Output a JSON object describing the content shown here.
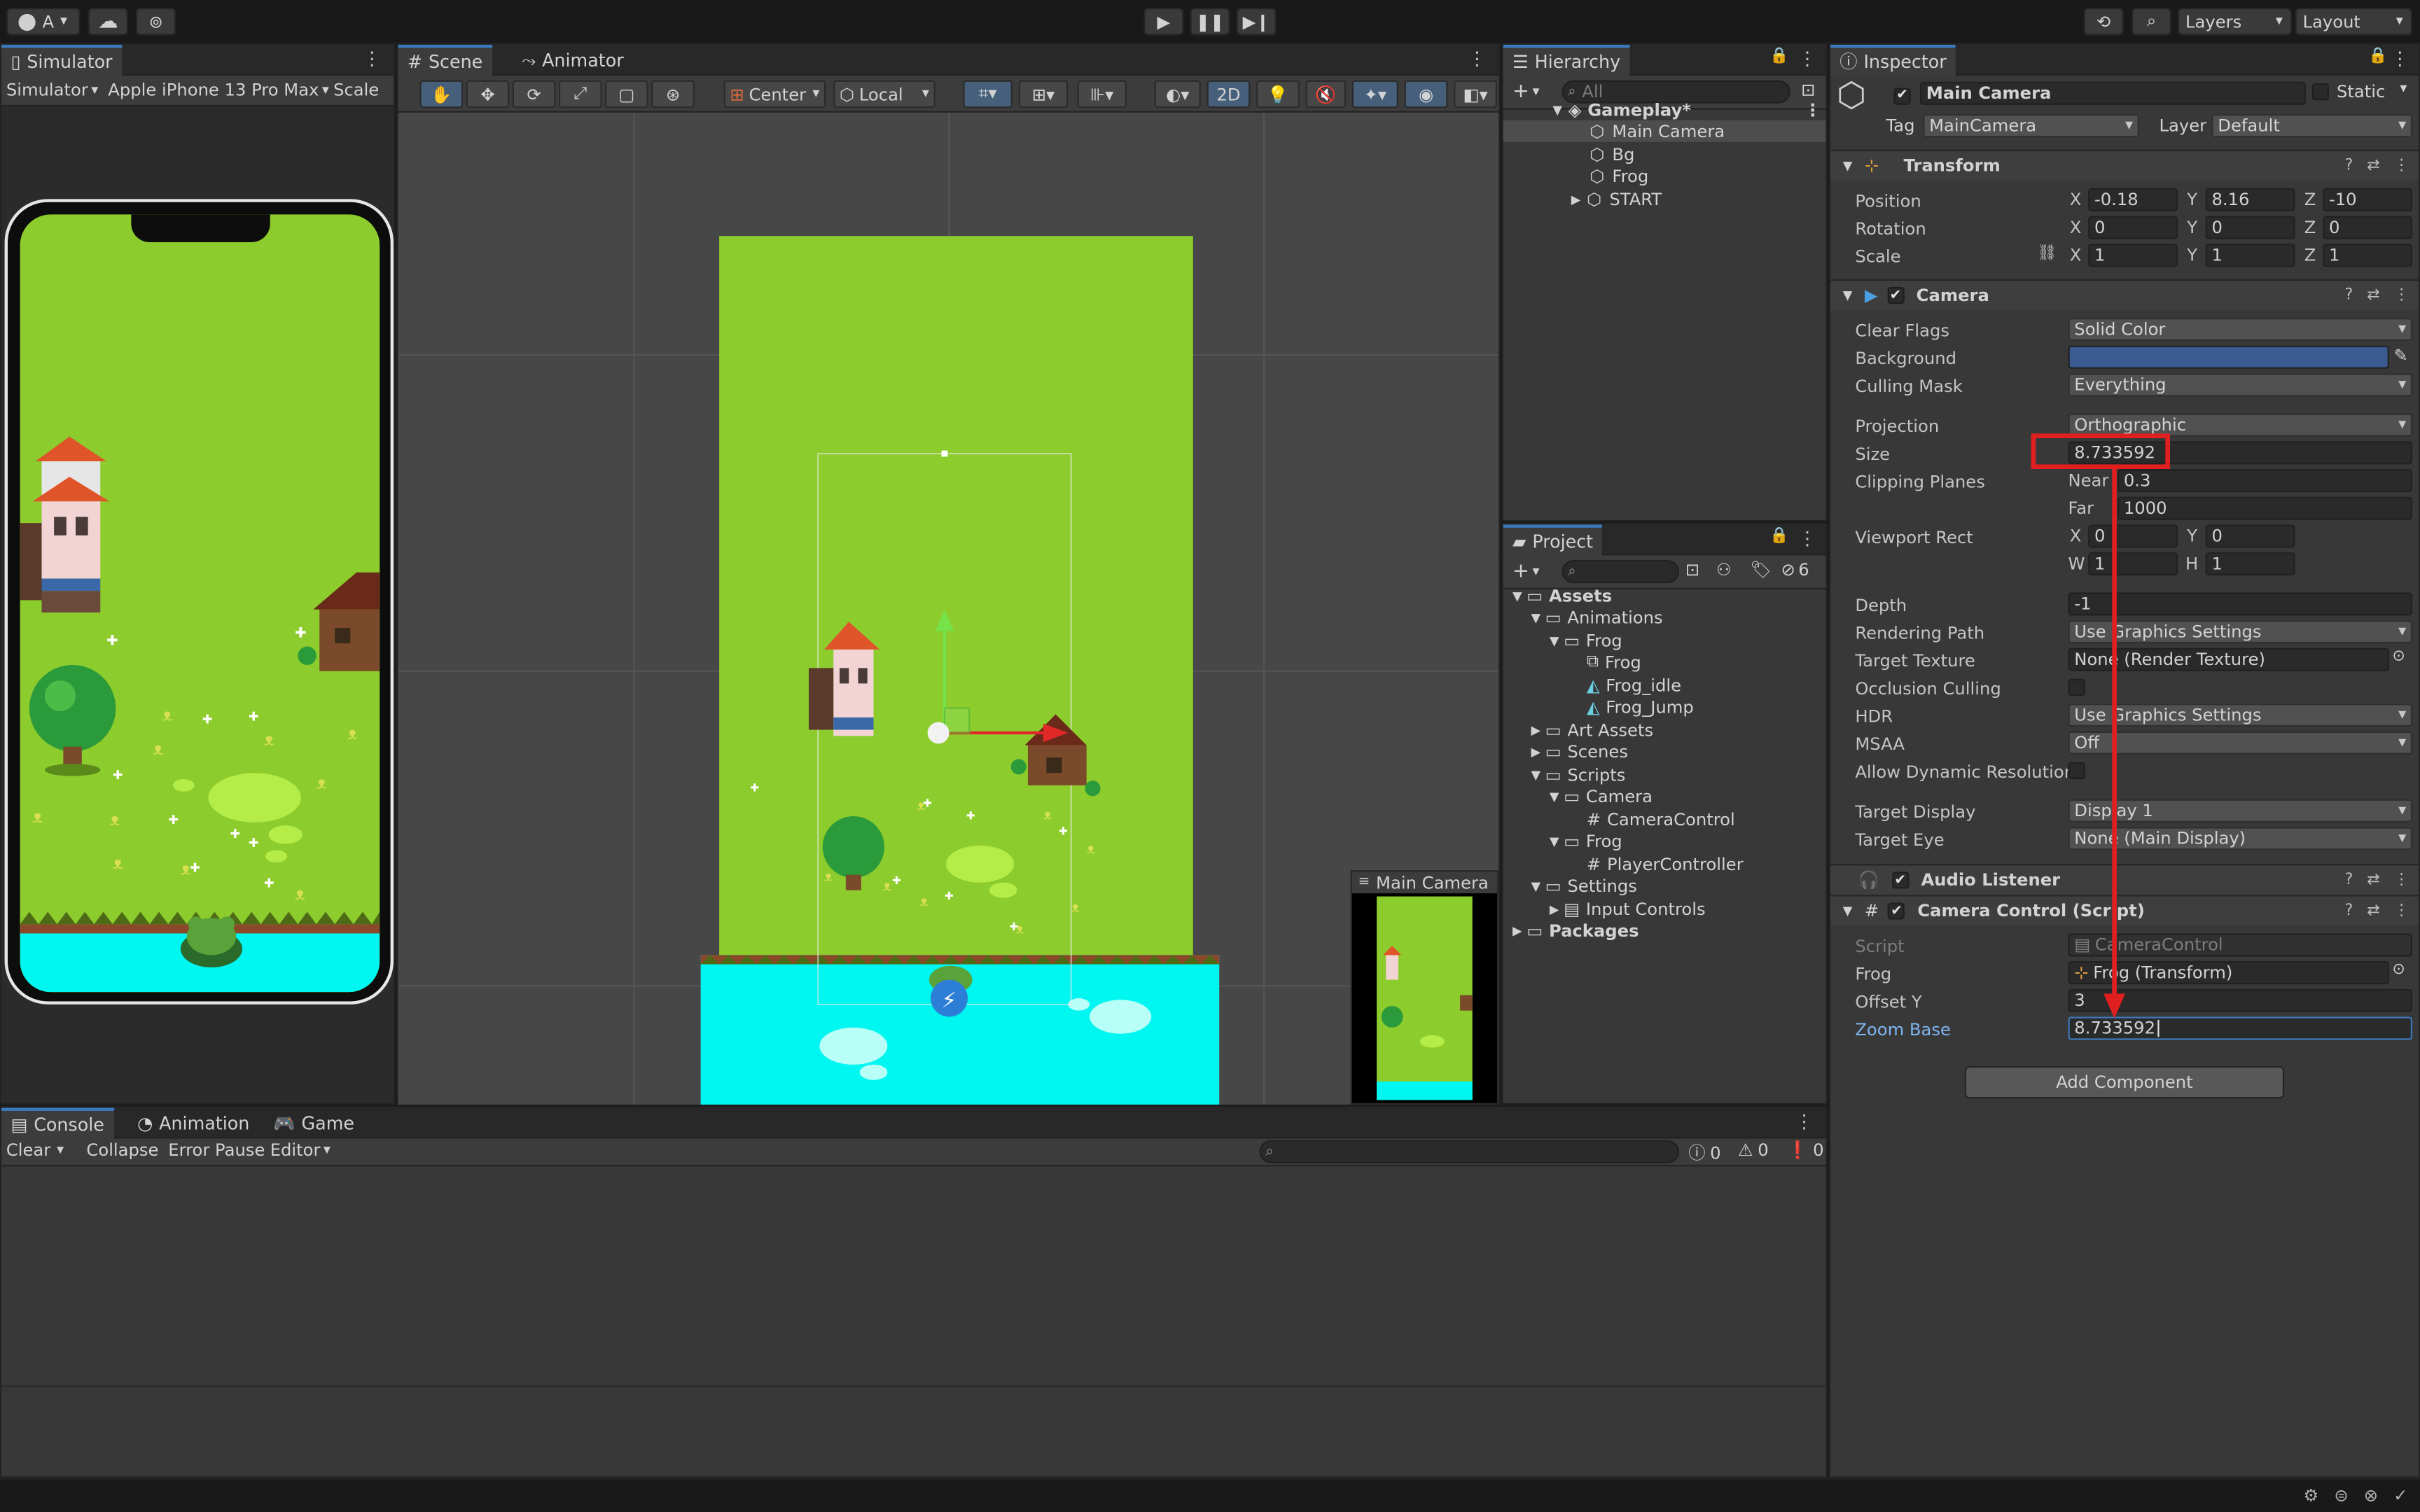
{
  "toolbar": {
    "account": "A",
    "layers": "Layers",
    "layout": "Layout"
  },
  "simulator": {
    "tab": "Simulator",
    "mode": "Simulator",
    "device": "Apple iPhone 13 Pro Max",
    "scale": "Scale"
  },
  "scene": {
    "tab_scene": "Scene",
    "tab_animator": "Animator",
    "pivot": "Center",
    "space": "Local",
    "mode2d": "2D",
    "camera_preview": "Main Camera"
  },
  "hierarchy": {
    "tab": "Hierarchy",
    "search_placeholder": "All",
    "items": [
      {
        "label": "Gameplay*"
      },
      {
        "label": "Main Camera"
      },
      {
        "label": "Bg"
      },
      {
        "label": "Frog"
      },
      {
        "label": "START"
      }
    ]
  },
  "project": {
    "tab": "Project",
    "count": "6",
    "items": [
      {
        "label": "Assets"
      },
      {
        "label": "Animations"
      },
      {
        "label": "Frog"
      },
      {
        "label": "Frog"
      },
      {
        "label": "Frog_idle"
      },
      {
        "label": "Frog_Jump"
      },
      {
        "label": "Art Assets"
      },
      {
        "label": "Scenes"
      },
      {
        "label": "Scripts"
      },
      {
        "label": "Camera"
      },
      {
        "label": "CameraControl"
      },
      {
        "label": "Frog"
      },
      {
        "label": "PlayerController"
      },
      {
        "label": "Settings"
      },
      {
        "label": "Input Controls"
      },
      {
        "label": "Packages"
      }
    ]
  },
  "console": {
    "tabs": [
      "Console",
      "Animation",
      "Game"
    ],
    "buttons": [
      "Clear",
      "Collapse",
      "Error Pause",
      "Editor"
    ],
    "counts": [
      "0",
      "0",
      "0"
    ]
  },
  "inspector": {
    "tab": "Inspector",
    "object_name": "Main Camera",
    "static_label": "Static",
    "tag_label": "Tag",
    "tag_value": "MainCamera",
    "layer_label": "Layer",
    "layer_value": "Default",
    "transform": {
      "title": "Transform",
      "position_label": "Position",
      "rotation_label": "Rotation",
      "scale_label": "Scale",
      "position": [
        "-0.18",
        "8.16",
        "-10"
      ],
      "rotation": [
        "0",
        "0",
        "0"
      ],
      "scale": [
        "1",
        "1",
        "1"
      ],
      "axes": [
        "X",
        "Y",
        "Z"
      ]
    },
    "camera": {
      "title": "Camera",
      "clear_flags_label": "Clear Flags",
      "clear_flags": "Solid Color",
      "background_label": "Background",
      "background_color": "#3b5a8f",
      "culling_mask_label": "Culling Mask",
      "culling_mask": "Everything",
      "projection_label": "Projection",
      "projection": "Orthographic",
      "size_label": "Size",
      "size": "8.733592",
      "clipping_label": "Clipping Planes",
      "near_label": "Near",
      "near": "0.3",
      "far_label": "Far",
      "far": "1000",
      "viewport_label": "Viewport Rect",
      "vp_x_label": "X",
      "vp_x": "0",
      "vp_y_label": "Y",
      "vp_y": "0",
      "vp_w_label": "W",
      "vp_w": "1",
      "vp_h_label": "H",
      "vp_h": "1",
      "depth_label": "Depth",
      "depth": "-1",
      "rendering_path_label": "Rendering Path",
      "rendering_path": "Use Graphics Settings",
      "target_texture_label": "Target Texture",
      "target_texture": "None (Render Texture)",
      "occlusion_label": "Occlusion Culling",
      "hdr_label": "HDR",
      "hdr": "Use Graphics Settings",
      "msaa_label": "MSAA",
      "msaa": "Off",
      "dyn_res_label": "Allow Dynamic Resolution",
      "target_display_label": "Target Display",
      "target_display": "Display 1",
      "target_eye_label": "Target Eye",
      "target_eye": "None (Main Display)"
    },
    "audio_listener": "Audio Listener",
    "camera_control": {
      "title": "Camera Control (Script)",
      "script_label": "Script",
      "script": "CameraControl",
      "frog_label": "Frog",
      "frog": "Frog (Transform)",
      "offset_label": "Offset Y",
      "offset": "3",
      "zoom_label": "Zoom Base",
      "zoom": "8.733592"
    },
    "add_component": "Add Component"
  },
  "colors": {
    "accent": "#3a79bb",
    "highlight": "#e02020",
    "grass": "#8ccc2c",
    "water": "#00f6f0"
  }
}
